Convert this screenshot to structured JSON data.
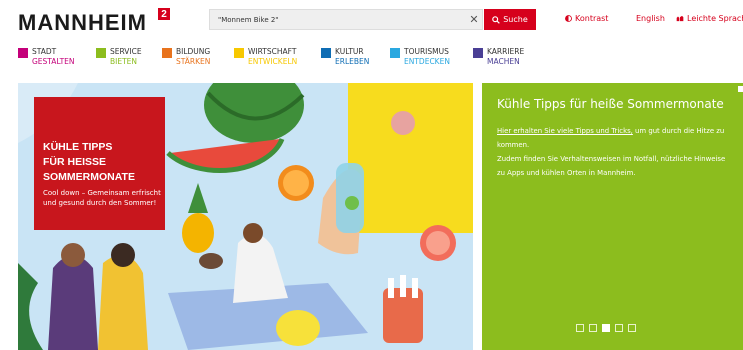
{
  "header": {
    "logo_text": "MANNHEIM",
    "logo_sup": "2",
    "search_value": "\"Monnem Bike 2\"",
    "search_button_label": "Suche",
    "links": [
      {
        "label": "Kontrast",
        "icon": "contrast-icon"
      },
      {
        "label": "English"
      },
      {
        "label": "Leichte Sprache",
        "icon": "easy-language-icon"
      }
    ]
  },
  "categories": [
    {
      "line1": "Stadt",
      "line2": "gestalten",
      "color": "#c4007a"
    },
    {
      "line1": "Service",
      "line2": "bieten",
      "color": "#8cbd1e"
    },
    {
      "line1": "Bildung",
      "line2": "stärken",
      "color": "#e8731d"
    },
    {
      "line1": "Wirtschaft",
      "line2": "entwickeln",
      "color": "#f7c800"
    },
    {
      "line1": "Kultur",
      "line2": "erleben",
      "color": "#0f6db4"
    },
    {
      "line1": "Tourismus",
      "line2": "entdecken",
      "color": "#2aa8e0"
    },
    {
      "line1": "Karriere",
      "line2": "machen",
      "color": "#4a3f95"
    }
  ],
  "hero": {
    "promo_title_lines": [
      "Kühle Tipps",
      "für heisse",
      "Sommermonate"
    ],
    "promo_body": "Cool down – Gemeinsam erfrischt und gesund durch den Sommer!"
  },
  "panel": {
    "title": "Kühle Tipps für heiße Sommermonate",
    "link_text": "Hier erhalten Sie viele Tipps und Tricks,",
    "text_after_link": " um gut durch die Hitze zu kommen.",
    "paragraph2": "Zudem finden Sie Verhaltensweisen im Notfall, nützliche Hinweise zu Apps und kühlen Orten in Mannheim."
  },
  "slider": {
    "count": 5,
    "active_index": 2
  },
  "colors": {
    "brand_red": "#d6001c",
    "panel_green": "#8cbd1e",
    "hero_sky": "#c9e4f5"
  }
}
